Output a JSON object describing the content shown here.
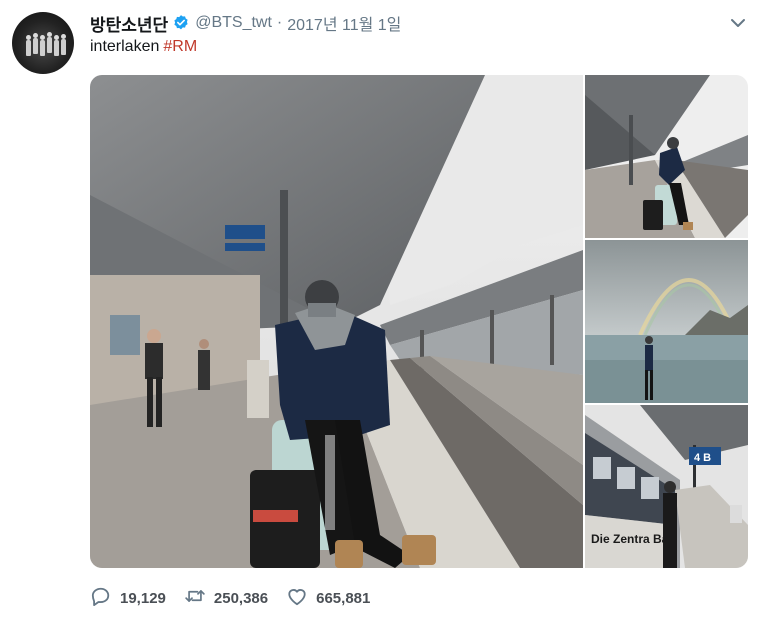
{
  "tweet": {
    "display_name": "방탄소년단",
    "handle": "@BTS_twt",
    "separator": "·",
    "date": "2017년 11월 1일",
    "text": "interlaken",
    "hashtag": "#RM"
  },
  "stats": {
    "replies": "19,129",
    "retweets": "250,386",
    "likes": "665,881"
  },
  "media": {
    "photos": [
      {
        "subject": "man sitting on suitcase on train platform, wearing beanie and parka"
      },
      {
        "subject": "man sitting on suitcase on train platform, wide view"
      },
      {
        "subject": "man standing by lake with rainbow and mountains"
      },
      {
        "subject": "man standing next to Swiss train"
      }
    ],
    "train_lettering": "Die Zentra Ba",
    "platform_sign": "4 B"
  },
  "icons": {
    "verified": "verified-badge-icon",
    "caret": "chevron-down-icon",
    "reply": "reply-icon",
    "retweet": "retweet-icon",
    "like": "heart-icon"
  },
  "colors": {
    "hashtag": "#c0392b",
    "verified": "#1da1f2",
    "muted": "#657786"
  }
}
